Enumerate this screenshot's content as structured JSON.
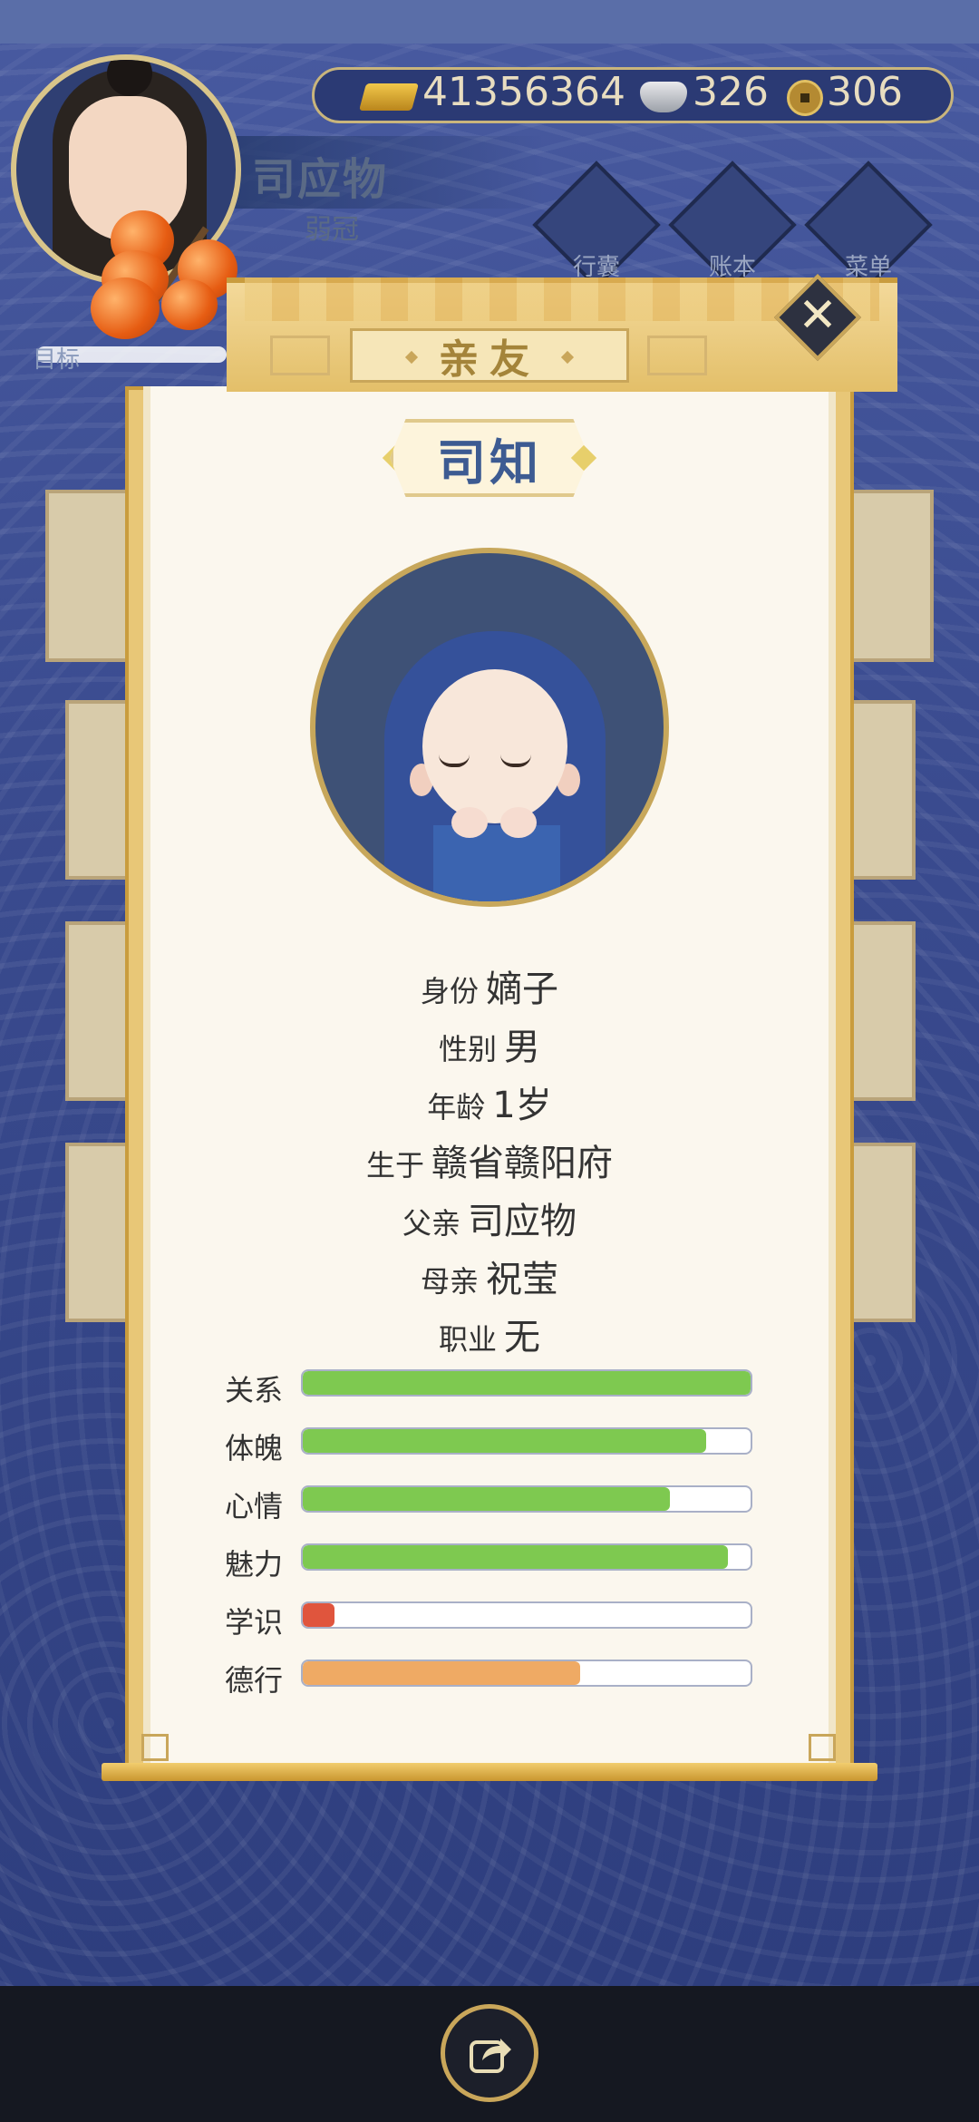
{
  "player": {
    "name": "司应物",
    "title": "弱冠"
  },
  "currency": {
    "gold": "41356364",
    "silver": "326",
    "coin": "306"
  },
  "menu": {
    "bag": "行囊",
    "ledger": "账本",
    "menu": "菜单"
  },
  "target_label": "目标",
  "modal": {
    "title": "亲友",
    "character_name": "司知",
    "info": [
      {
        "label": "身份",
        "value": "嫡子"
      },
      {
        "label": "性别",
        "value": "男"
      },
      {
        "label": "年龄",
        "value": "1岁"
      },
      {
        "label": "生于",
        "value": "赣省赣阳府"
      },
      {
        "label": "父亲",
        "value": "司应物"
      },
      {
        "label": "母亲",
        "value": "祝莹"
      },
      {
        "label": "职业",
        "value": "无"
      }
    ],
    "stats": [
      {
        "label": "关系",
        "fraction": 1.0,
        "color": "#7ec950"
      },
      {
        "label": "体魄",
        "fraction": 0.9,
        "color": "#7ec950"
      },
      {
        "label": "心情",
        "fraction": 0.82,
        "color": "#7ec950"
      },
      {
        "label": "魅力",
        "fraction": 0.95,
        "color": "#7ec950"
      },
      {
        "label": "学识",
        "fraction": 0.07,
        "color": "#e0553d"
      },
      {
        "label": "德行",
        "fraction": 0.62,
        "color": "#efaa64"
      }
    ]
  },
  "icons": {
    "close": "close-icon",
    "share": "share-icon"
  }
}
